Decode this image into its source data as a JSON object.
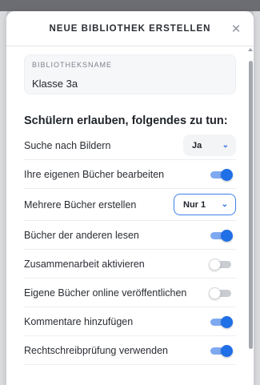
{
  "dialog": {
    "title": "NEUE BIBLIOTHEK ERSTELLEN",
    "close_symbol": "×"
  },
  "name_field": {
    "label": "BIBLIOTHEKSNAME",
    "value": "Klasse 3a"
  },
  "section": {
    "title": "Schülern erlauben, folgendes zu tun:"
  },
  "settings": [
    {
      "label": "Suche nach Bildern",
      "control": "select",
      "value": "Ja"
    },
    {
      "label": "Ihre eigenen Bücher bearbeiten",
      "control": "toggle",
      "on": true
    },
    {
      "label": "Mehrere Bücher erstellen",
      "control": "select",
      "value": "Nur 1"
    },
    {
      "label": "Bücher der anderen lesen",
      "control": "toggle",
      "on": true
    },
    {
      "label": "Zusammenarbeit aktivieren",
      "control": "toggle",
      "on": false
    },
    {
      "label": "Eigene Bücher online veröffentlichen",
      "control": "toggle",
      "on": false
    },
    {
      "label": "Kommentare hinzufügen",
      "control": "toggle",
      "on": true
    },
    {
      "label": "Rechtschreibprüfung verwenden",
      "control": "toggle",
      "on": true
    }
  ],
  "colors": {
    "accent": "#1f6fe6",
    "toggle_track_on": "#7ea9f0",
    "toggle_track_off": "#c9ccd1"
  },
  "icons": {
    "close": "close-icon",
    "chevron": "chevron-down-icon"
  }
}
